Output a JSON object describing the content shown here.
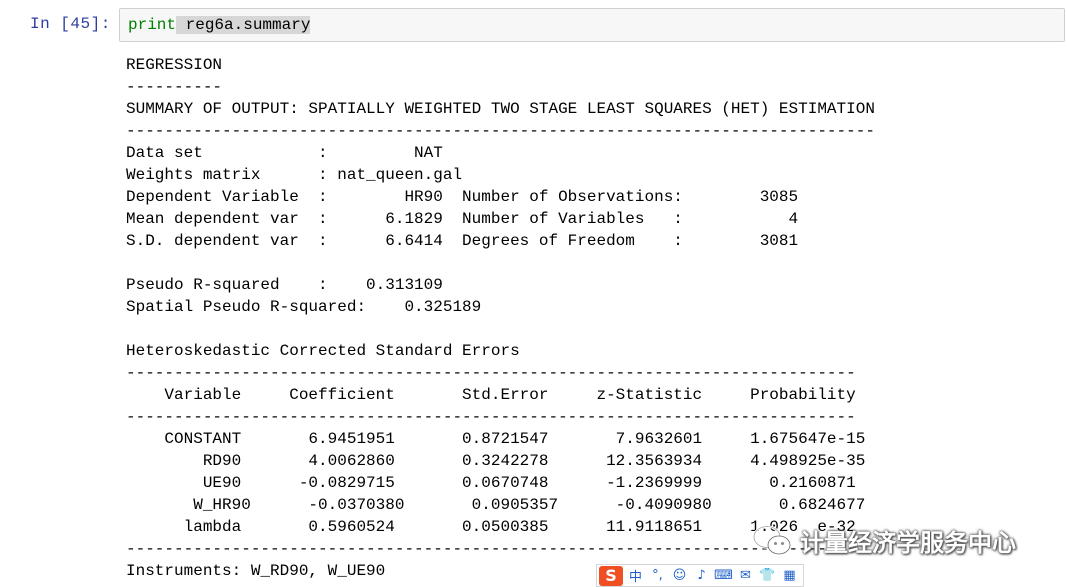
{
  "cell": {
    "prompt": "In  [45]:",
    "code_keyword": "print",
    "code_rest": " reg6a.summary"
  },
  "output": {
    "lines": [
      "REGRESSION",
      "----------",
      "SUMMARY OF OUTPUT: SPATIALLY WEIGHTED TWO STAGE LEAST SQUARES (HET) ESTIMATION",
      "------------------------------------------------------------------------------",
      "Data set            :         NAT",
      "Weights matrix      : nat_queen.gal",
      "Dependent Variable  :        HR90  Number of Observations:        3085",
      "Mean dependent var  :      6.1829  Number of Variables   :           4",
      "S.D. dependent var  :      6.6414  Degrees of Freedom    :        3081",
      "",
      "Pseudo R-squared    :    0.313109",
      "Spatial Pseudo R-squared:    0.325189",
      "",
      "Heteroskedastic Corrected Standard Errors",
      "----------------------------------------------------------------------------",
      "    Variable     Coefficient       Std.Error     z-Statistic     Probability",
      "----------------------------------------------------------------------------",
      "    CONSTANT       6.9451951       0.8721547       7.9632601     1.675647e-15",
      "        RD90       4.0062860       0.3242278      12.3563934     4.498925e-35",
      "        UE90      -0.0829715       0.0670748      -1.2369999       0.2160871",
      "       W_HR90      -0.0370380       0.0905357      -0.4090980       0.6824677",
      "      lambda       0.5960524       0.0500385      11.9118651     1.026  e-32",
      "----------------------------------------------------------------------------",
      "Instruments: W_RD90, W_UE90"
    ]
  },
  "watermark": {
    "text": "计量经济学服务中心",
    "icon": "wechat-icon"
  },
  "ime_toolbar": {
    "logo": "S",
    "items": [
      {
        "label": "中",
        "icon": "chinese-mode-icon"
      },
      {
        "label": "°,",
        "icon": "punctuation-icon"
      },
      {
        "label": "☺",
        "icon": "emoji-icon"
      },
      {
        "label": "♪",
        "icon": "voice-icon"
      },
      {
        "label": "⌨",
        "icon": "keyboard-icon"
      },
      {
        "label": "✉",
        "icon": "skin-icon"
      },
      {
        "label": "👕",
        "icon": "shirt-icon"
      },
      {
        "label": "▦",
        "icon": "toolbox-icon"
      }
    ]
  },
  "colors": {
    "prompt": "#303f9f",
    "keyword": "#008000",
    "cell_bg": "#f7f7f7",
    "ime_logo": "#f04e23"
  }
}
